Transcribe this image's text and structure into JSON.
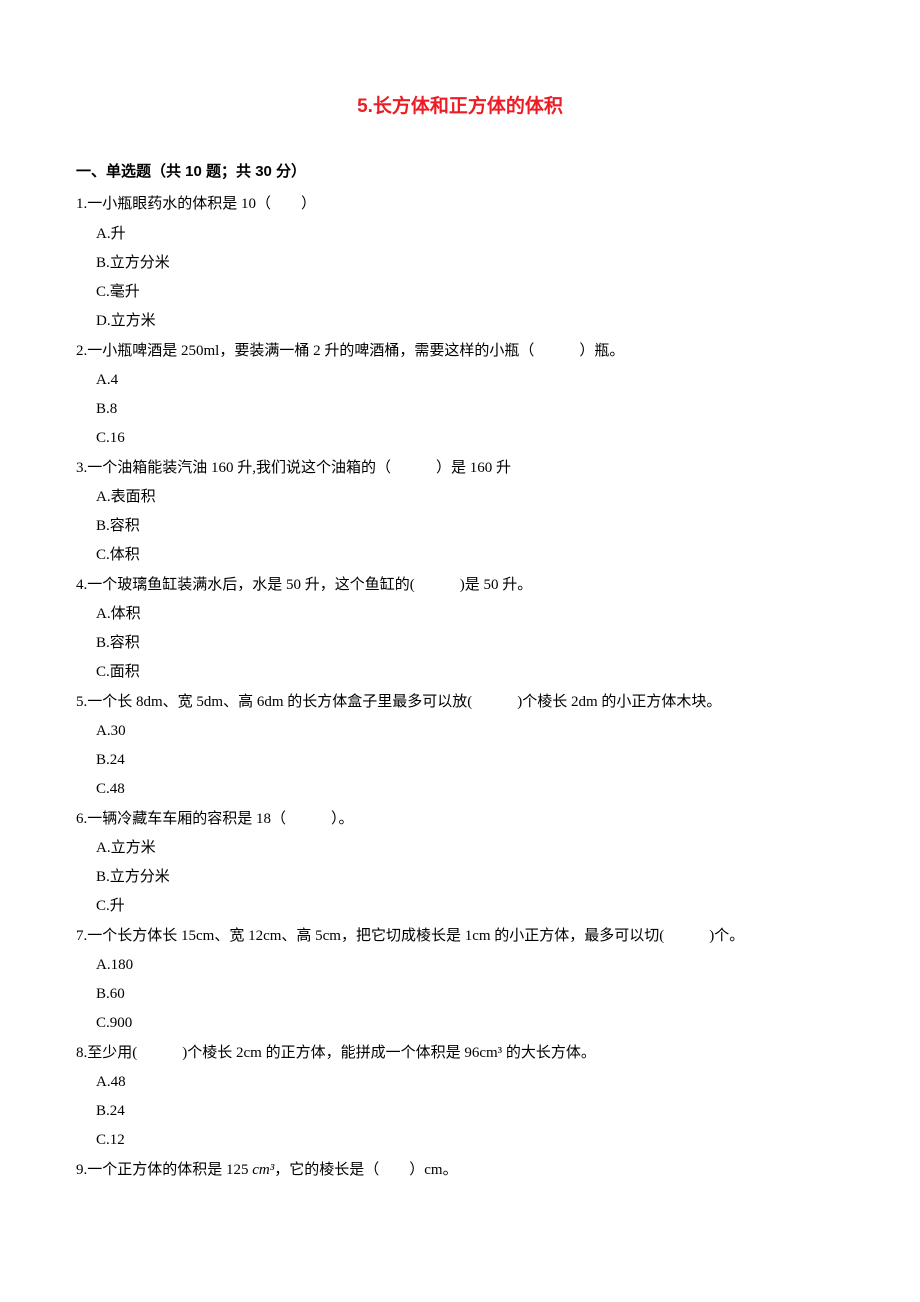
{
  "title": "5.长方体和正方体的体积",
  "section_header": "一、单选题（共 10 题；共 30 分）",
  "questions": [
    {
      "text": "1.一小瓶眼药水的体积是 10（　　）",
      "options": [
        "A.升",
        "B.立方分米",
        "C.毫升",
        "D.立方米"
      ]
    },
    {
      "text": "2.一小瓶啤酒是 250ml，要装满一桶 2 升的啤酒桶，需要这样的小瓶（　　　）瓶。",
      "options": [
        "A.4",
        "B.8",
        "C.16"
      ]
    },
    {
      "text": "3.一个油箱能装汽油 160 升,我们说这个油箱的（　　　）是 160 升",
      "options": [
        "A.表面积",
        "B.容积",
        "C.体积"
      ]
    },
    {
      "text": "4.一个玻璃鱼缸装满水后，水是 50 升，这个鱼缸的(　　　)是 50 升。",
      "options": [
        "A.体积",
        "B.容积",
        "C.面积"
      ]
    },
    {
      "text": "5.一个长 8dm、宽 5dm、高 6dm 的长方体盒子里最多可以放(　　　)个棱长 2dm 的小正方体木块。",
      "options": [
        "A.30",
        "B.24",
        "C.48"
      ]
    },
    {
      "text": "6.一辆冷藏车车厢的容积是 18（　　　）。",
      "options": [
        "A.立方米",
        "B.立方分米",
        "C.升"
      ]
    },
    {
      "text": "7.一个长方体长 15cm、宽 12cm、高 5cm，把它切成棱长是 1cm 的小正方体，最多可以切(　　　)个。",
      "options": [
        "A.180",
        "B.60",
        "C.900"
      ]
    },
    {
      "text": "8.至少用(　　　)个棱长 2cm 的正方体，能拼成一个体积是 96cm³ 的大长方体。",
      "options": [
        "A.48",
        "B.24",
        "C.12"
      ]
    },
    {
      "text_prefix": "9.一个正方体的体积是 125 ",
      "text_mid": "cm³",
      "text_suffix": "，它的棱长是（　　）cm。",
      "options": []
    }
  ]
}
